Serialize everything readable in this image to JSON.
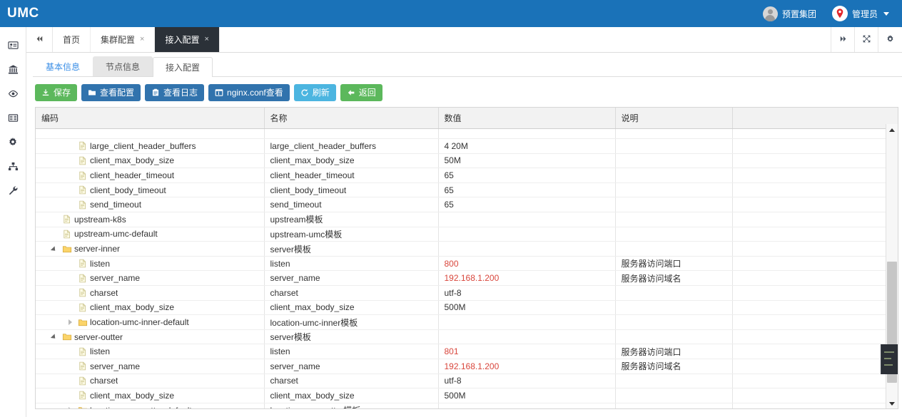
{
  "brand": "UMC",
  "topbar": {
    "org_label": "预置集团",
    "user_label": "管理员",
    "avatar_icon": "user-avatar-icon",
    "pin_icon": "map-pin-icon",
    "caret_icon": "chevron-down-icon"
  },
  "sidebar": {
    "items": [
      {
        "icon": "id-card-icon",
        "name": "sidebar-item-id-card"
      },
      {
        "icon": "bank-icon",
        "name": "sidebar-item-bank"
      },
      {
        "icon": "eye-icon",
        "name": "sidebar-item-monitor"
      },
      {
        "icon": "list-icon",
        "name": "sidebar-item-list"
      },
      {
        "icon": "gear-icon",
        "name": "sidebar-item-settings"
      },
      {
        "icon": "sitemap-icon",
        "name": "sidebar-item-sitemap"
      },
      {
        "icon": "wrench-icon",
        "name": "sidebar-item-tools"
      }
    ]
  },
  "tabbar": {
    "collapse_icon": "double-chevron-left-icon",
    "tabs": [
      {
        "label": "首页",
        "closable": false,
        "active": false
      },
      {
        "label": "集群配置",
        "closable": true,
        "active": false
      },
      {
        "label": "接入配置",
        "closable": true,
        "active": true
      }
    ],
    "close_glyph": "×",
    "tools": [
      {
        "icon": "double-chevron-right-icon",
        "name": "tab-scroll-right-button"
      },
      {
        "icon": "fullscreen-icon",
        "name": "fullscreen-button"
      },
      {
        "icon": "gear-icon",
        "name": "tab-settings-button"
      }
    ]
  },
  "subtabs": [
    {
      "label": "基本信息",
      "state": "link"
    },
    {
      "label": "节点信息",
      "state": "hovered"
    },
    {
      "label": "接入配置",
      "state": "active"
    }
  ],
  "toolbar": {
    "buttons": [
      {
        "label": "保存",
        "style": "green",
        "icon": "download-icon"
      },
      {
        "label": "查看配置",
        "style": "blue",
        "icon": "folder-icon"
      },
      {
        "label": "查看日志",
        "style": "blue",
        "icon": "clipboard-icon"
      },
      {
        "label": "nginx.conf查看",
        "style": "blue",
        "icon": "window-icon"
      },
      {
        "label": "刷新",
        "style": "cyan",
        "icon": "refresh-icon"
      },
      {
        "label": "返回",
        "style": "green",
        "icon": "arrow-left-icon"
      }
    ]
  },
  "table": {
    "columns": [
      "编码",
      "名称",
      "数值",
      "说明",
      ""
    ],
    "rows": [
      {
        "indent": 2,
        "twisty": "none",
        "icon": "file-icon",
        "code": "large_client_header_buffers",
        "name": "large_client_header_buffers",
        "value": "4 20M",
        "value_red": false,
        "desc": ""
      },
      {
        "indent": 2,
        "twisty": "none",
        "icon": "file-icon",
        "code": "client_max_body_size",
        "name": "client_max_body_size",
        "value": "50M",
        "value_red": false,
        "desc": ""
      },
      {
        "indent": 2,
        "twisty": "none",
        "icon": "file-icon",
        "code": "client_header_timeout",
        "name": "client_header_timeout",
        "value": "65",
        "value_red": false,
        "desc": ""
      },
      {
        "indent": 2,
        "twisty": "none",
        "icon": "file-icon",
        "code": "client_body_timeout",
        "name": "client_body_timeout",
        "value": "65",
        "value_red": false,
        "desc": ""
      },
      {
        "indent": 2,
        "twisty": "none",
        "icon": "file-icon",
        "code": "send_timeout",
        "name": "send_timeout",
        "value": "65",
        "value_red": false,
        "desc": ""
      },
      {
        "indent": 1,
        "twisty": "none",
        "icon": "file-icon",
        "code": "upstream-k8s",
        "name": "upstream模板",
        "value": "",
        "value_red": false,
        "desc": ""
      },
      {
        "indent": 1,
        "twisty": "none",
        "icon": "file-icon",
        "code": "upstream-umc-default",
        "name": "upstream-umc模板",
        "value": "",
        "value_red": false,
        "desc": ""
      },
      {
        "indent": 1,
        "twisty": "open",
        "icon": "folder-icon",
        "code": "server-inner",
        "name": "server模板",
        "value": "",
        "value_red": false,
        "desc": ""
      },
      {
        "indent": 2,
        "twisty": "none",
        "icon": "file-icon",
        "code": "listen",
        "name": "listen",
        "value": "800",
        "value_red": true,
        "desc": "服务器访问端口"
      },
      {
        "indent": 2,
        "twisty": "none",
        "icon": "file-icon",
        "code": "server_name",
        "name": "server_name",
        "value": "192.168.1.200",
        "value_red": true,
        "desc": "服务器访问域名"
      },
      {
        "indent": 2,
        "twisty": "none",
        "icon": "file-icon",
        "code": "charset",
        "name": "charset",
        "value": "utf-8",
        "value_red": false,
        "desc": ""
      },
      {
        "indent": 2,
        "twisty": "none",
        "icon": "file-icon",
        "code": "client_max_body_size",
        "name": "client_max_body_size",
        "value": "500M",
        "value_red": false,
        "desc": ""
      },
      {
        "indent": 2,
        "twisty": "closed",
        "icon": "folder-icon",
        "code": "location-umc-inner-default",
        "name": "location-umc-inner模板",
        "value": "",
        "value_red": false,
        "desc": ""
      },
      {
        "indent": 1,
        "twisty": "open",
        "icon": "folder-icon",
        "code": "server-outter",
        "name": "server模板",
        "value": "",
        "value_red": false,
        "desc": ""
      },
      {
        "indent": 2,
        "twisty": "none",
        "icon": "file-icon",
        "code": "listen",
        "name": "listen",
        "value": "801",
        "value_red": true,
        "desc": "服务器访问端口"
      },
      {
        "indent": 2,
        "twisty": "none",
        "icon": "file-icon",
        "code": "server_name",
        "name": "server_name",
        "value": "192.168.1.200",
        "value_red": true,
        "desc": "服务器访问域名"
      },
      {
        "indent": 2,
        "twisty": "none",
        "icon": "file-icon",
        "code": "charset",
        "name": "charset",
        "value": "utf-8",
        "value_red": false,
        "desc": ""
      },
      {
        "indent": 2,
        "twisty": "none",
        "icon": "file-icon",
        "code": "client_max_body_size",
        "name": "client_max_body_size",
        "value": "500M",
        "value_red": false,
        "desc": ""
      },
      {
        "indent": 2,
        "twisty": "closed",
        "icon": "folder-icon",
        "code": "location-umc-outter-default",
        "name": "location-umc-outter模板",
        "value": "",
        "value_red": false,
        "desc": ""
      }
    ]
  },
  "colors": {
    "brand_blue": "#1a72b8",
    "active_tab_dark": "#2b3138",
    "btn_green": "#5cb85c",
    "btn_blue": "#3173ad",
    "btn_cyan": "#4cb5e0",
    "value_red": "#d9463c"
  }
}
